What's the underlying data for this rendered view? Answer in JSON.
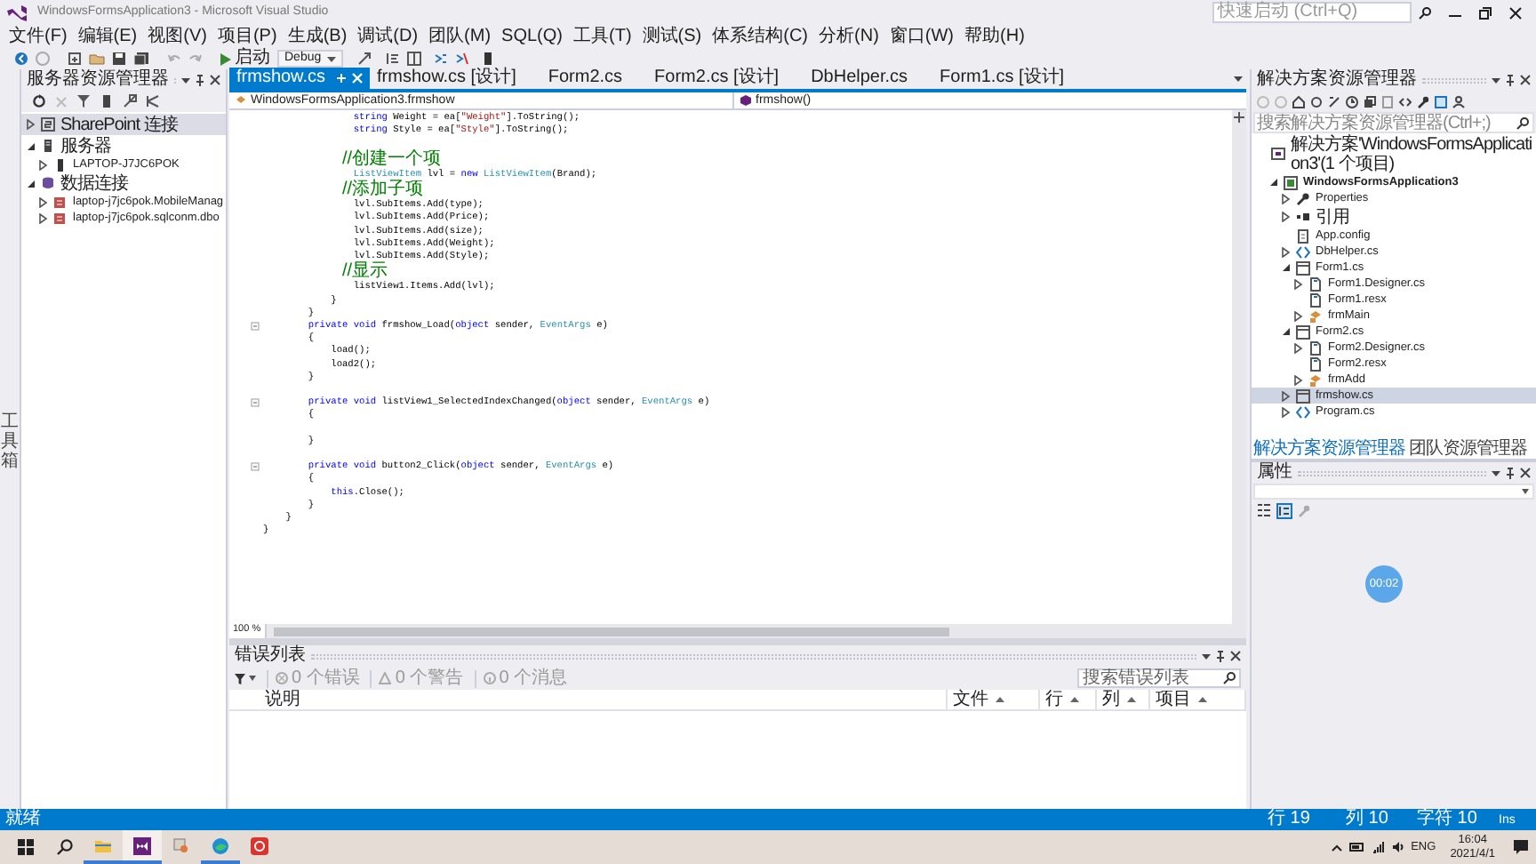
{
  "window": {
    "title": "WindowsFormsApplication3 - Microsoft Visual Studio",
    "quick_launch": {
      "placeholder": "快速启动 (Ctrl+Q)"
    }
  },
  "menu": [
    "文件(F)",
    "编辑(E)",
    "视图(V)",
    "项目(P)",
    "生成(B)",
    "调试(D)",
    "团队(M)",
    "SQL(Q)",
    "工具(T)",
    "测试(S)",
    "体系结构(C)",
    "分析(N)",
    "窗口(W)",
    "帮助(H)"
  ],
  "toolbar": {
    "start_label": "启动",
    "configuration": "Debug"
  },
  "left_strip": {
    "label": "工具箱"
  },
  "server_explorer": {
    "title": "服务器资源管理器",
    "items": [
      {
        "label": "SharePoint 连接",
        "kind": "site",
        "expanded": false,
        "selected": true
      },
      {
        "label": "服务器",
        "kind": "servers",
        "expanded": true,
        "selected": false,
        "children": [
          {
            "label": "LAPTOP-J7JC6POK",
            "kind": "machine",
            "expanded": false,
            "selected": false
          }
        ]
      },
      {
        "label": "数据连接",
        "kind": "connections",
        "expanded": true,
        "selected": false,
        "children": [
          {
            "label": "laptop-j7jc6pok.MobileManag",
            "kind": "database",
            "expanded": false,
            "selected": false
          },
          {
            "label": "laptop-j7jc6pok.sqlconm.dbo",
            "kind": "database",
            "expanded": false,
            "selected": false
          }
        ]
      }
    ]
  },
  "editor": {
    "tabs": [
      {
        "label": "frmshow.cs",
        "selected": true
      },
      {
        "label": "frmshow.cs [设计]",
        "selected": false
      },
      {
        "label": "Form2.cs",
        "selected": false
      },
      {
        "label": "Form2.cs [设计]",
        "selected": false
      },
      {
        "label": "DbHelper.cs",
        "selected": false
      },
      {
        "label": "Form1.cs [设计]",
        "selected": false
      }
    ],
    "nav_class": "WindowsFormsApplication3.frmshow",
    "nav_member": "frmshow()",
    "lines": [
      {
        "kind": "code",
        "segments": [
          {
            "kind": "keyword",
            "text": "                string"
          },
          {
            "kind": "plain",
            "text": " Weight = ea["
          },
          {
            "kind": "string",
            "text": "\"Weight\""
          },
          {
            "kind": "plain",
            "text": "].ToString();"
          }
        ]
      },
      {
        "kind": "code",
        "segments": [
          {
            "kind": "keyword",
            "text": "                string"
          },
          {
            "kind": "plain",
            "text": " Style = ea["
          },
          {
            "kind": "string",
            "text": "\"Style\""
          },
          {
            "kind": "plain",
            "text": "].ToString();"
          }
        ]
      },
      {
        "kind": "blank"
      },
      {
        "kind": "code",
        "segments": [
          {
            "kind": "comment",
            "text": "                //创建一个项"
          }
        ]
      },
      {
        "kind": "code",
        "segments": [
          {
            "kind": "type",
            "text": "                ListViewItem"
          },
          {
            "kind": "plain",
            "text": " lvl = "
          },
          {
            "kind": "keyword",
            "text": "new"
          },
          {
            "kind": "type",
            "text": " ListViewItem"
          },
          {
            "kind": "plain",
            "text": "(Brand);"
          }
        ]
      },
      {
        "kind": "code",
        "segments": [
          {
            "kind": "comment",
            "text": "                //添加子项"
          }
        ]
      },
      {
        "kind": "code",
        "segments": [
          {
            "kind": "plain",
            "text": "                lvl.SubItems.Add(type);"
          }
        ]
      },
      {
        "kind": "code",
        "segments": [
          {
            "kind": "plain",
            "text": "                lvl.SubItems.Add(Price);"
          }
        ]
      },
      {
        "kind": "code",
        "segments": [
          {
            "kind": "plain",
            "text": "                lvl.SubItems.Add(size);"
          }
        ]
      },
      {
        "kind": "code",
        "segments": [
          {
            "kind": "plain",
            "text": "                lvl.SubItems.Add(Weight);"
          }
        ]
      },
      {
        "kind": "code",
        "segments": [
          {
            "kind": "plain",
            "text": "                lvl.SubItems.Add(Style);"
          }
        ]
      },
      {
        "kind": "code",
        "segments": [
          {
            "kind": "comment",
            "text": "                //显示"
          }
        ]
      },
      {
        "kind": "code",
        "segments": [
          {
            "kind": "plain",
            "text": "                listView1.Items.Add(lvl);"
          }
        ]
      },
      {
        "kind": "code",
        "segments": [
          {
            "kind": "plain",
            "text": "            }"
          }
        ]
      },
      {
        "kind": "code",
        "segments": [
          {
            "kind": "plain",
            "text": "        }"
          }
        ]
      },
      {
        "kind": "code",
        "fold": true,
        "segments": [
          {
            "kind": "keyword",
            "text": "        private void"
          },
          {
            "kind": "plain",
            "text": " frmshow_Load("
          },
          {
            "kind": "keyword",
            "text": "object"
          },
          {
            "kind": "plain",
            "text": " sender, "
          },
          {
            "kind": "type",
            "text": "EventArgs"
          },
          {
            "kind": "plain",
            "text": " e)"
          }
        ]
      },
      {
        "kind": "code",
        "segments": [
          {
            "kind": "plain",
            "text": "        {"
          }
        ]
      },
      {
        "kind": "code",
        "segments": [
          {
            "kind": "plain",
            "text": "            load();"
          }
        ]
      },
      {
        "kind": "code",
        "segments": [
          {
            "kind": "plain",
            "text": "            load2();"
          }
        ]
      },
      {
        "kind": "code",
        "segments": [
          {
            "kind": "plain",
            "text": "        }"
          }
        ]
      },
      {
        "kind": "blank"
      },
      {
        "kind": "code",
        "fold": true,
        "segments": [
          {
            "kind": "keyword",
            "text": "        private void"
          },
          {
            "kind": "plain",
            "text": " listView1_SelectedIndexChanged("
          },
          {
            "kind": "keyword",
            "text": "object"
          },
          {
            "kind": "plain",
            "text": " sender, "
          },
          {
            "kind": "type",
            "text": "EventArgs"
          },
          {
            "kind": "plain",
            "text": " e)"
          }
        ]
      },
      {
        "kind": "code",
        "segments": [
          {
            "kind": "plain",
            "text": "        {"
          }
        ]
      },
      {
        "kind": "blank"
      },
      {
        "kind": "code",
        "segments": [
          {
            "kind": "plain",
            "text": "        }"
          }
        ]
      },
      {
        "kind": "blank"
      },
      {
        "kind": "code",
        "fold": true,
        "segments": [
          {
            "kind": "keyword",
            "text": "        private void"
          },
          {
            "kind": "plain",
            "text": " button2_Click("
          },
          {
            "kind": "keyword",
            "text": "object"
          },
          {
            "kind": "plain",
            "text": " sender, "
          },
          {
            "kind": "type",
            "text": "EventArgs"
          },
          {
            "kind": "plain",
            "text": " e)"
          }
        ]
      },
      {
        "kind": "code",
        "segments": [
          {
            "kind": "plain",
            "text": "        {"
          }
        ]
      },
      {
        "kind": "code",
        "segments": [
          {
            "kind": "keyword",
            "text": "            this"
          },
          {
            "kind": "plain",
            "text": ".Close();"
          }
        ]
      },
      {
        "kind": "code",
        "segments": [
          {
            "kind": "plain",
            "text": "        }"
          }
        ]
      },
      {
        "kind": "code",
        "segments": [
          {
            "kind": "plain",
            "text": "    }"
          }
        ]
      },
      {
        "kind": "code",
        "segments": [
          {
            "kind": "plain",
            "text": "}"
          }
        ]
      }
    ],
    "zoom": "100 %"
  },
  "error_list": {
    "title": "错误列表",
    "filters": [
      {
        "kind": "error",
        "label": "0 个错误"
      },
      {
        "kind": "warning",
        "label": "0 个警告"
      },
      {
        "kind": "info",
        "label": "0 个消息"
      }
    ],
    "search": {
      "placeholder": "搜索错误列表"
    },
    "columns": [
      "说明",
      "文件",
      "行",
      "列",
      "项目"
    ]
  },
  "solution_explorer": {
    "title": "解决方案资源管理器",
    "search": {
      "placeholder": "搜索解决方案资源管理器(Ctrl+;)"
    },
    "items": [
      {
        "label": "解决方案'WindowsFormsApplication3'(1 个项目)",
        "kind": "solution",
        "selected": false,
        "children": [
          {
            "label": "WindowsFormsApplication3",
            "kind": "project",
            "expanded": true,
            "selected": false,
            "children": [
              {
                "label": "Properties",
                "kind": "properties",
                "expanded": false,
                "selected": false
              },
              {
                "label": "引用",
                "kind": "references",
                "expanded": false,
                "selected": false
              },
              {
                "label": "App.config",
                "kind": "config",
                "selected": false
              },
              {
                "label": "DbHelper.cs",
                "kind": "code",
                "expanded": false,
                "selected": false
              },
              {
                "label": "Form1.cs",
                "kind": "form",
                "expanded": true,
                "selected": false,
                "children": [
                  {
                    "label": "Form1.Designer.cs",
                    "kind": "designer",
                    "expanded": false,
                    "selected": false
                  },
                  {
                    "label": "Form1.resx",
                    "kind": "designer",
                    "selected": false
                  },
                  {
                    "label": "frmMain",
                    "kind": "class",
                    "expanded": false,
                    "selected": false
                  }
                ]
              },
              {
                "label": "Form2.cs",
                "kind": "form",
                "expanded": true,
                "selected": false,
                "children": [
                  {
                    "label": "Form2.Designer.cs",
                    "kind": "designer",
                    "expanded": false,
                    "selected": false
                  },
                  {
                    "label": "Form2.resx",
                    "kind": "designer",
                    "selected": false
                  },
                  {
                    "label": "frmAdd",
                    "kind": "class",
                    "expanded": false,
                    "selected": false
                  }
                ]
              },
              {
                "label": "frmshow.cs",
                "kind": "form",
                "expanded": false,
                "selected": true
              },
              {
                "label": "Program.cs",
                "kind": "code",
                "expanded": false,
                "selected": false
              }
            ]
          }
        ]
      }
    ]
  },
  "panel_tabs": [
    {
      "label": "解决方案资源管理器",
      "selected": true
    },
    {
      "label": "团队资源管理器",
      "selected": false
    }
  ],
  "properties": {
    "title": "属性"
  },
  "recording_badge": "00:02",
  "status_bar": {
    "message": "就绪",
    "line": "行 19",
    "column": "列 10",
    "char": "字符 10",
    "mode": "Ins"
  },
  "taskbar": {
    "apps": [
      {
        "kind": "folder",
        "running": true,
        "selected": false
      },
      {
        "kind": "studio",
        "running": true,
        "selected": true
      },
      {
        "kind": "paint",
        "running": false,
        "selected": false
      },
      {
        "kind": "browser",
        "running": true,
        "selected": false
      },
      {
        "kind": "music",
        "running": false,
        "selected": false
      }
    ],
    "language": "ENG",
    "time": "16:04",
    "date": "2021/4/1"
  }
}
